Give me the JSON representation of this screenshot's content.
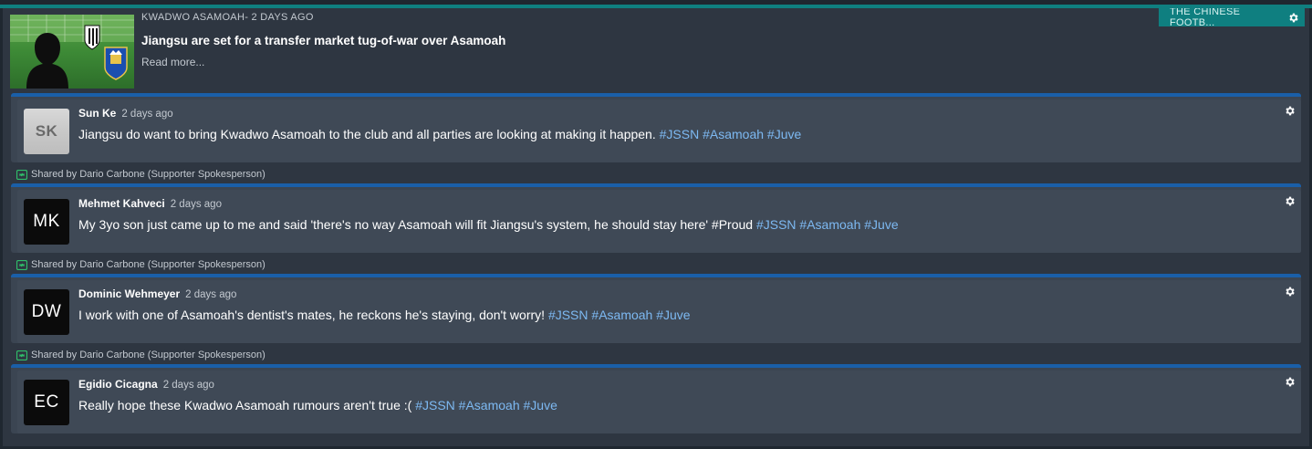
{
  "source_tag": {
    "label": "THE CHINESE FOOTB..."
  },
  "news": {
    "meta": "KWADWO ASAMOAH- 2 DAYS AGO",
    "headline": "Jiangsu are set for a transfer market tug-of-war over Asamoah",
    "read_more": "Read more..."
  },
  "posts": [
    {
      "initials": "SK",
      "author": "Sun Ke",
      "time": "2 days ago",
      "text": "Jiangsu do want to bring Kwadwo Asamoah to the club and all parties are looking at making it happen.",
      "hashtags": [
        "#JSSN",
        "#Asamoah",
        "#Juve"
      ]
    },
    {
      "initials": "MK",
      "author": "Mehmet Kahveci",
      "time": "2 days ago",
      "text": "My 3yo son just came up to me and said 'there's no way Asamoah will fit Jiangsu's system, he should stay here' #Proud",
      "hashtags": [
        "#JSSN",
        "#Asamoah",
        "#Juve"
      ],
      "shared_by": "Shared by Dario Carbone (Supporter Spokesperson)"
    },
    {
      "initials": "DW",
      "author": "Dominic Wehmeyer",
      "time": "2 days ago",
      "text": "I work with one of Asamoah's dentist's mates, he reckons he's staying, don't worry!",
      "hashtags": [
        "#JSSN",
        "#Asamoah",
        "#Juve"
      ],
      "shared_by": "Shared by Dario Carbone (Supporter Spokesperson)"
    },
    {
      "initials": "EC",
      "author": "Egidio Cicagna",
      "time": "2 days ago",
      "text": "Really hope these Kwadwo Asamoah rumours aren't true :(",
      "hashtags": [
        "#JSSN",
        "#Asamoah",
        "#Juve"
      ],
      "shared_by": "Shared by Dario Carbone (Supporter Spokesperson)"
    }
  ],
  "colors": {
    "accent_teal": "#0f7f80",
    "post_border_blue": "#1a5fa8",
    "hashtag": "#7db9f2",
    "share_icon": "#2fbf6a"
  }
}
